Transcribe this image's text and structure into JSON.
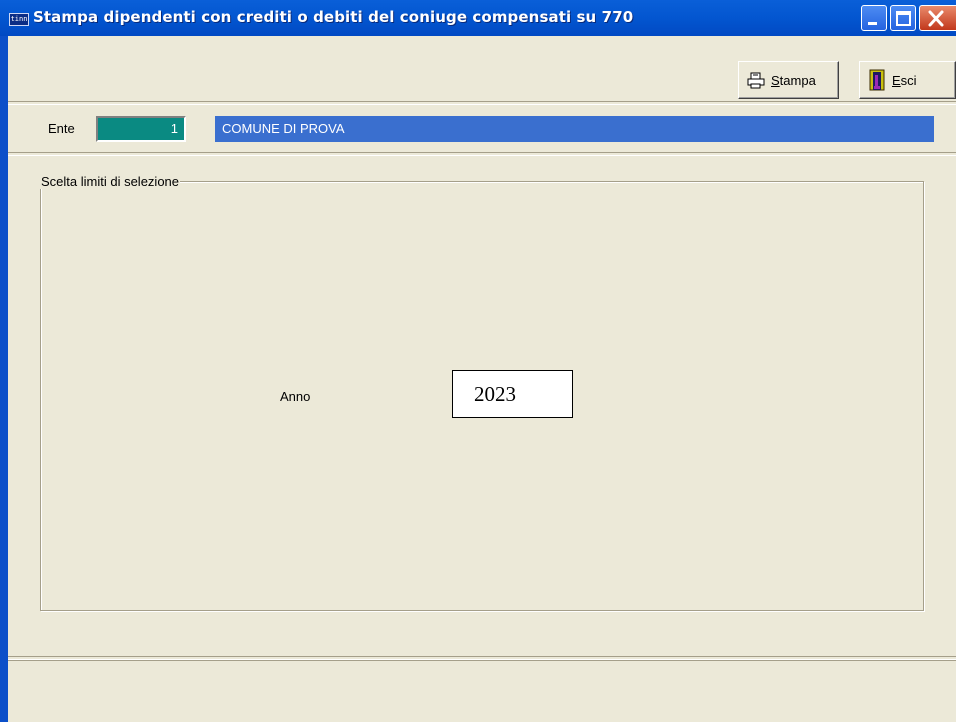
{
  "window": {
    "icon_text": "tinn",
    "title": "Stampa dipendenti con crediti o debiti del coniuge compensati su 770"
  },
  "toolbar": {
    "stampa_prefix": "",
    "stampa_mnemonic": "S",
    "stampa_rest": "tampa",
    "esci_mnemonic": "E",
    "esci_rest": "sci"
  },
  "ente": {
    "label": "Ente",
    "code": "1",
    "name": "COMUNE DI PROVA"
  },
  "selection": {
    "group_title": "Scelta limiti di selezione",
    "anno_label": "Anno",
    "anno_value": "2023"
  },
  "colors": {
    "titlebar": "#0356d0",
    "ente_code_bg": "#0a8a82",
    "ente_name_bg": "#3a6fcf",
    "window_bg": "#ece9d8"
  }
}
